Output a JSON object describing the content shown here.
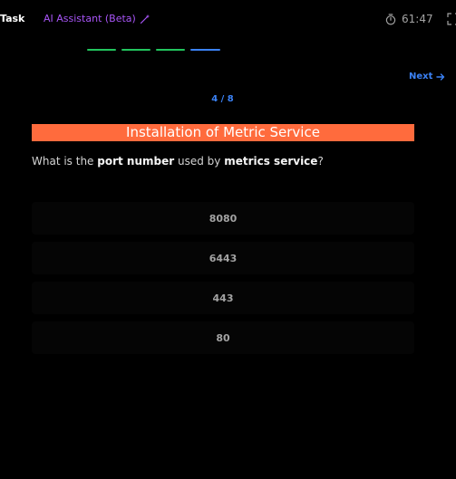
{
  "header": {
    "task_tab_label": "Task",
    "ai_tab_label": "AI Assistant (Beta)",
    "ai_icon": "magic-wand-icon",
    "timer_icon": "stopwatch-icon",
    "timer_value": "61:47",
    "expand_icon": "expand-icon"
  },
  "progress": {
    "segments": [
      "complete",
      "complete",
      "complete",
      "current"
    ],
    "colors": {
      "complete": "#22c55e",
      "current": "#3b82f6"
    }
  },
  "nav": {
    "next_label": "Next",
    "next_icon": "arrow-right-icon",
    "counter": "4 / 8"
  },
  "question": {
    "title": "Installation of Metric Service",
    "text_parts": [
      "What is the ",
      "port number",
      " used by ",
      "metrics service",
      "?"
    ],
    "options": [
      "8080",
      "6443",
      "443",
      "80"
    ]
  },
  "colors": {
    "title_bg": "#ff6b3d",
    "accent_blue": "#3b82f6",
    "ai_purple": "#a855f7"
  }
}
